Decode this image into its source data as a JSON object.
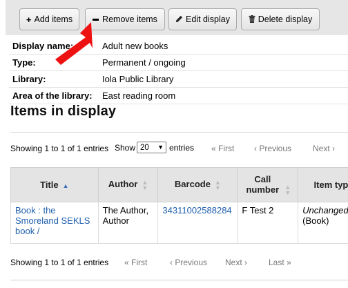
{
  "toolbar": {
    "add_label": "Add items",
    "remove_label": "Remove items",
    "edit_label": "Edit display",
    "delete_label": "Delete display"
  },
  "details": [
    {
      "label": "Display name:",
      "value": "Adult new books"
    },
    {
      "label": "Type:",
      "value": "Permanent / ongoing"
    },
    {
      "label": "Library:",
      "value": "Iola Public Library"
    },
    {
      "label": "Area of the library:",
      "value": "East reading room"
    }
  ],
  "section_title": "Items in display",
  "pager": {
    "info": "Showing 1 to 1 of 1 entries",
    "show": "Show",
    "page_size": "20",
    "entries": "entries",
    "first": "« First",
    "previous": "‹ Previous",
    "next": "Next ›",
    "last": "Last »"
  },
  "table": {
    "headers": {
      "title": "Title",
      "author": "Author",
      "barcode": "Barcode",
      "call_number": "Call number",
      "item_type": "Item type"
    },
    "rows": [
      {
        "title": "Book : the Smoreland SEKLS book /",
        "author": "The Author, Author",
        "barcode": "34311002588284",
        "call_number": "F Test 2",
        "item_type_status": "Unchanged",
        "item_type": "(Book)"
      }
    ]
  },
  "colors": {
    "toolbar_bg": "#e6e6e6",
    "link": "#1f5fae",
    "arrow": "#ee1111",
    "header_bg": "#e4e4e4"
  },
  "icons": {
    "add": "plus-icon",
    "remove": "minus-icon",
    "edit": "pencil-icon",
    "delete": "trash-icon"
  }
}
